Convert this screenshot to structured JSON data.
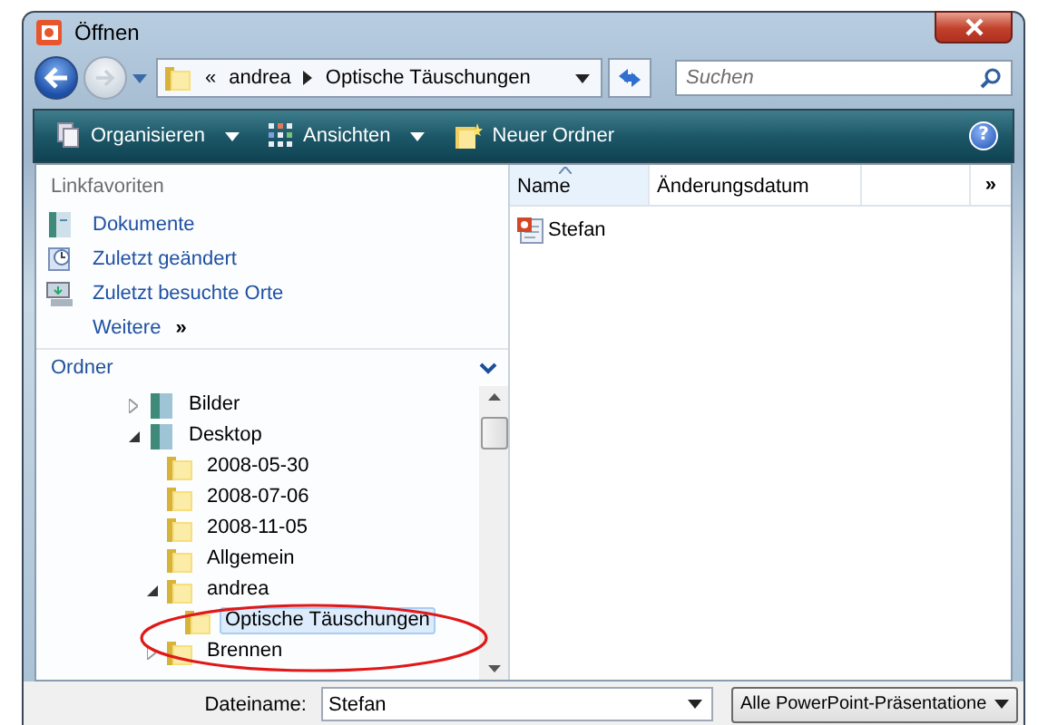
{
  "window": {
    "title": "Öffnen"
  },
  "address": {
    "overflow": "«",
    "path": [
      "andrea",
      "Optische Täuschungen"
    ]
  },
  "search": {
    "placeholder": "Suchen"
  },
  "toolbar": [
    {
      "label": "Organisieren",
      "kind": "menu"
    },
    {
      "label": "Ansichten",
      "kind": "menu"
    },
    {
      "label": "Neuer Ordner",
      "kind": "button"
    }
  ],
  "help": "?",
  "favorites": {
    "heading": "Linkfavoriten",
    "items": [
      {
        "label": "Dokumente",
        "kind": "documents"
      },
      {
        "label": "Zuletzt geändert",
        "kind": "recent"
      },
      {
        "label": "Zuletzt besuchte Orte",
        "kind": "places"
      }
    ],
    "more": {
      "label": "Weitere",
      "glyph": "»"
    }
  },
  "folders": {
    "heading": "Ordner",
    "tree": [
      {
        "label": "Bilder",
        "kind": "library",
        "expanded": false,
        "selected": false
      },
      {
        "label": "Desktop",
        "kind": "library",
        "expanded": true,
        "selected": false,
        "children": [
          {
            "label": "2008-05-30",
            "kind": "folder",
            "selected": false
          },
          {
            "label": "2008-07-06",
            "kind": "folder",
            "selected": false
          },
          {
            "label": "2008-11-05",
            "kind": "folder",
            "selected": false
          },
          {
            "label": "Allgemein",
            "kind": "folder",
            "selected": false
          },
          {
            "label": "andrea",
            "kind": "folder",
            "expanded": true,
            "selected": false,
            "children": [
              {
                "label": "Optische Täuschungen",
                "kind": "folder",
                "selected": true
              }
            ]
          },
          {
            "label": "Brennen",
            "kind": "folder",
            "expanded": false,
            "selected": false
          }
        ]
      }
    ]
  },
  "file_list": {
    "columns": [
      {
        "label": "Name",
        "sorted": true
      },
      {
        "label": "Änderungsdatum",
        "sorted": false
      }
    ],
    "more": "»",
    "files": [
      {
        "name": "Stefan",
        "kind": "presentation"
      }
    ]
  },
  "filename": {
    "label": "Dateiname:",
    "value": "Stefan"
  },
  "file_type": {
    "value": "Alle PowerPoint-Präsentatione"
  },
  "highlight": true
}
